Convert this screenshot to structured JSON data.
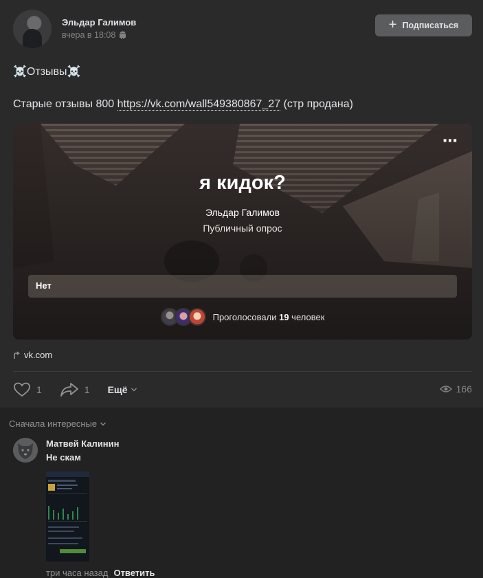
{
  "post": {
    "author": "Эльдар Галимов",
    "time": "вчера в 18:08",
    "subscribe_label": "Подписаться",
    "title_line": "☠️Отзывы☠️",
    "text_prefix": "Старые отзывы 800 ",
    "text_link": "https://vk.com/wall549380867_27",
    "text_suffix": " (стр продана)"
  },
  "poll": {
    "question": "я кидок?",
    "author": "Эльдар Галимов",
    "type": "Публичный опрос",
    "option": "Нет",
    "voters_prefix": "Проголосовали ",
    "voters_count": "19",
    "voters_suffix": " человек",
    "more_icon": "⋯"
  },
  "link": {
    "label": "vk.com"
  },
  "actions": {
    "likes": "1",
    "shares": "1",
    "more_label": "Ещё",
    "views": "166"
  },
  "comments": {
    "sort_label": "Сначала интересные",
    "items": [
      {
        "author": "Матвей Калинин",
        "text": "Не скам",
        "time": "три часа назад",
        "reply_label": "Ответить"
      }
    ]
  }
}
